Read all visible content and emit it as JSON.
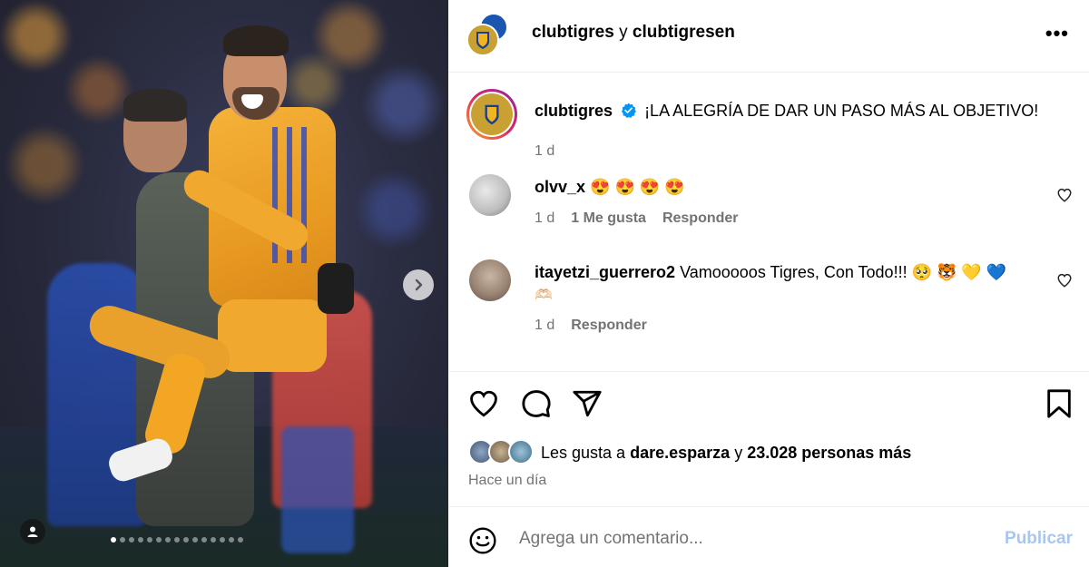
{
  "header": {
    "user1": "clubtigres",
    "connector": "y",
    "user2": "clubtigresen",
    "more_label": "•••"
  },
  "caption": {
    "username": "clubtigres",
    "text": "¡LA ALEGRÍA DE DAR UN PASO MÁS AL OBJETIVO!",
    "time": "1 d"
  },
  "comments": [
    {
      "username": "olvv_x",
      "text": "😍 😍 😍 😍",
      "time": "1 d",
      "likes": "1 Me gusta",
      "reply": "Responder"
    },
    {
      "username": "itayetzi_guerrero2",
      "text": "Vamooooos Tigres, Con Todo!!! 🥺 🐯 💛 💙",
      "text_line2": "🫶🏻",
      "time": "1 d",
      "reply": "Responder"
    }
  ],
  "likes": {
    "prefix": "Les gusta a",
    "user": "dare.esparza",
    "connector": "y",
    "count_text": "23.028 personas más"
  },
  "timestamp": "Hace un día",
  "add_comment": {
    "placeholder": "Agrega un comentario...",
    "publish_label": "Publicar"
  },
  "carousel": {
    "total_slides": 15,
    "active_index": 0
  },
  "colors": {
    "verified": "#0095f6",
    "publish_disabled": "#a7c7f0",
    "muted_text": "#737373",
    "tigres_gold": "#f2a624",
    "tigres_blue": "#3a4db5"
  },
  "icons": {
    "like": "heart-icon",
    "comment": "comment-bubble-icon",
    "share": "paper-plane-icon",
    "save": "bookmark-icon",
    "emoji": "emoji-smiley-icon",
    "next": "chevron-right-icon",
    "tags": "user-tag-icon"
  }
}
